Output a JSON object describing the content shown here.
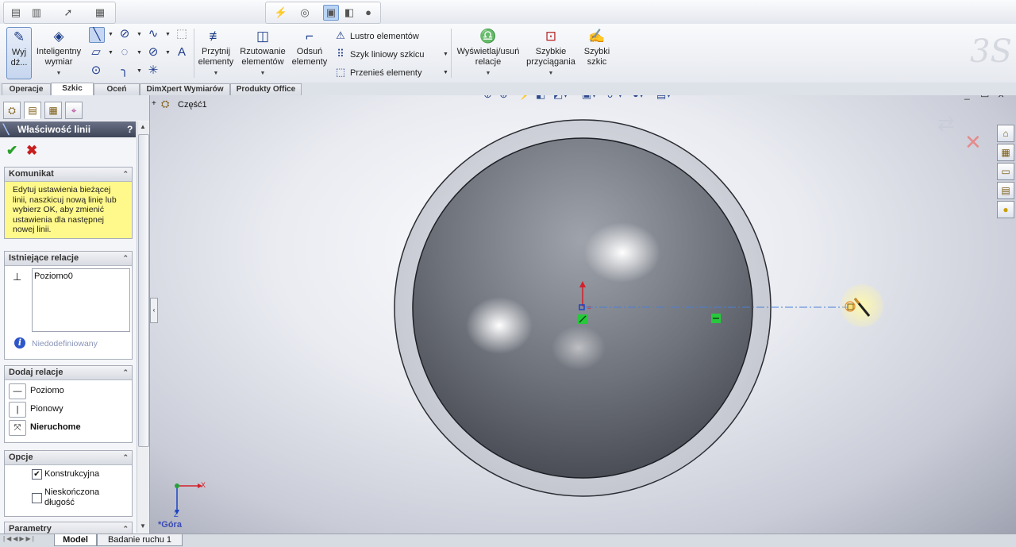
{
  "toolbar_top": {
    "icons": [
      "new-document-icon",
      "open-icon",
      "select-arrow-icon",
      "grid-icon",
      "view-sketch-relations-icon",
      "rebuild-icon",
      "shaded-icon",
      "section-view-icon",
      "appearance-icon"
    ]
  },
  "command_manager": {
    "exit_sketch": "Wyj dź...",
    "smart_dimension": "Inteligentny wymiar",
    "trim": "Przytnij elementy",
    "convert": "Rzutowanie elementów",
    "offset": "Odsuń elementy",
    "mirror": "Lustro elementów",
    "pattern": "Szyk liniowy szkicu",
    "move": "Przenieś elementy",
    "relations": "Wyświetlaj/usuń relacje",
    "snaps": "Szybkie przyciągania",
    "quick_sketch": "Szybki szkic"
  },
  "tabs": [
    "Operacje",
    "Szkic",
    "Oceń",
    "DimXpert Wymiarów",
    "Produkty Office"
  ],
  "active_tab": "Szkic",
  "property_manager": {
    "title": "Właściwość linii",
    "help": "?",
    "message_header": "Komunikat",
    "message": "Edytuj ustawienia bieżącej linii, naszkicuj nową linię lub wybierz OK, aby zmienić ustawienia dla następnej nowej linii.",
    "existing_relations_header": "Istniejące relacje",
    "relation_items": [
      "Poziomo0"
    ],
    "status": "Niedodefiniowany",
    "add_relations_header": "Dodaj relacje",
    "add_relations": [
      "Poziomo",
      "Pionowy",
      "Nieruchome"
    ],
    "options_header": "Opcje",
    "option_construction": "Konstrukcyjna",
    "option_infinite": "Nieskończona długość",
    "params_header": "Parametry"
  },
  "tree": {
    "part_name": "Część1"
  },
  "view": {
    "orientation": "*Góra"
  },
  "triad": {
    "x": "X",
    "z": "Z"
  },
  "bottom_tabs": [
    "Model",
    "Badanie ruchu 1"
  ],
  "window_controls": [
    "_",
    "▭",
    "×"
  ],
  "colors": {
    "accent": "#3f4558",
    "message_bg": "#fff88a",
    "sketch_line": "#4a7fd6",
    "relation_green": "#28c83c"
  }
}
